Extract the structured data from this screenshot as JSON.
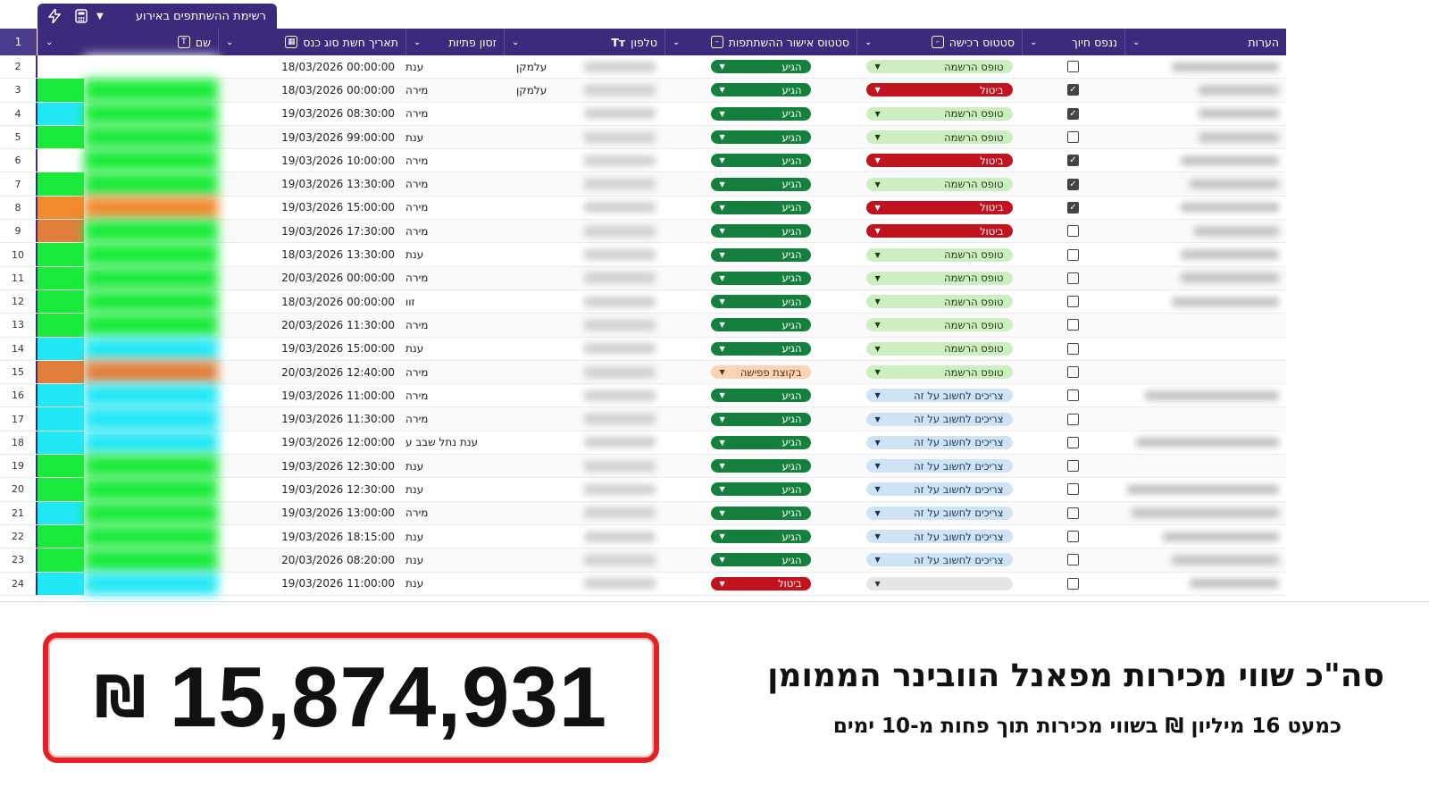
{
  "sheet": {
    "tab_title": "רשימת ההשתתפים באירוע",
    "columns": [
      {
        "key": "name",
        "label": "שם"
      },
      {
        "key": "date",
        "label": "תאריך חשת סוג כנס"
      },
      {
        "key": "slot",
        "label": "זסון פתיות"
      },
      {
        "key": "phone",
        "label": "טלפון"
      },
      {
        "key": "appr",
        "label": "סטטוס אישור ההשתתפות"
      },
      {
        "key": "reg",
        "label": "סטטוס רכישה"
      },
      {
        "key": "check",
        "label": "ננפס חיוך"
      },
      {
        "key": "notes",
        "label": "הערות"
      }
    ],
    "header_row_num": "1",
    "rows": [
      {
        "n": "2",
        "swatch": "#ffffff",
        "blur": "#ffffff",
        "date": "18/03/2026 00:00:00",
        "slot": "ענת",
        "extra": "עלמקן",
        "appr": "הגיע",
        "appr_style": "green",
        "reg": "טופס הרשמה",
        "reg_style": "lightgreen",
        "checked": false,
        "notes_w": 120
      },
      {
        "n": "3",
        "swatch": "#1aeb3a",
        "blur": "#1aeb3a",
        "date": "18/03/2026 00:00:00",
        "slot": "מירה",
        "extra": "עלמקן",
        "appr": "הגיע",
        "appr_style": "green",
        "reg": "ביטול",
        "reg_style": "red",
        "checked": true,
        "notes_w": 90
      },
      {
        "n": "4",
        "swatch": "#22e8f5",
        "blur": "#1aeb3a",
        "date": "19/03/2026 08:30:00",
        "slot": "מירה",
        "extra": "",
        "appr": "הגיע",
        "appr_style": "green",
        "reg": "טופס הרשמה",
        "reg_style": "lightgreen",
        "checked": true,
        "notes_w": 90
      },
      {
        "n": "5",
        "swatch": "#1aeb3a",
        "blur": "#1aeb3a",
        "date": "19/03/2026 99:00:00",
        "slot": "ענת",
        "extra": "",
        "appr": "הגיע",
        "appr_style": "green",
        "reg": "טופס הרשמה",
        "reg_style": "lightgreen",
        "checked": false,
        "notes_w": 90
      },
      {
        "n": "6",
        "swatch": "#ffffff",
        "blur": "#1aeb3a",
        "date": "19/03/2026 10:00:00",
        "slot": "מירה",
        "extra": "",
        "appr": "הגיע",
        "appr_style": "green",
        "reg": "ביטול",
        "reg_style": "red",
        "checked": true,
        "notes_w": 110
      },
      {
        "n": "7",
        "swatch": "#1aeb3a",
        "blur": "#1aeb3a",
        "date": "19/03/2026 13:30:00",
        "slot": "מירה",
        "extra": "",
        "appr": "הגיע",
        "appr_style": "green",
        "reg": "טופס הרשמה",
        "reg_style": "lightgreen",
        "checked": true,
        "notes_w": 100
      },
      {
        "n": "8",
        "swatch": "#f28a2e",
        "blur": "#f28a2e",
        "date": "19/03/2026 15:00:00",
        "slot": "מירה",
        "extra": "",
        "appr": "הגיע",
        "appr_style": "green",
        "reg": "ביטול",
        "reg_style": "red",
        "checked": true,
        "notes_w": 110
      },
      {
        "n": "9",
        "swatch": "#e07f3c",
        "blur": "#1aeb3a",
        "date": "19/03/2026 17:30:00",
        "slot": "מירה",
        "extra": "",
        "appr": "הגיע",
        "appr_style": "green",
        "reg": "ביטול",
        "reg_style": "red",
        "checked": false,
        "notes_w": 95
      },
      {
        "n": "10",
        "swatch": "#1aeb3a",
        "blur": "#1aeb3a",
        "date": "18/03/2026 13:30:00",
        "slot": "ענת",
        "extra": "",
        "appr": "הגיע",
        "appr_style": "green",
        "reg": "טופס הרשמה",
        "reg_style": "lightgreen",
        "checked": false,
        "notes_w": 110
      },
      {
        "n": "11",
        "swatch": "#1aeb3a",
        "blur": "#1aeb3a",
        "date": "20/03/2026 00:00:00",
        "slot": "מירה",
        "extra": "",
        "appr": "הגיע",
        "appr_style": "green",
        "reg": "טופס הרשמה",
        "reg_style": "lightgreen",
        "checked": false,
        "notes_w": 110
      },
      {
        "n": "12",
        "swatch": "#1aeb3a",
        "blur": "#1aeb3a",
        "date": "18/03/2026 00:00:00",
        "slot": "זוו",
        "extra": "",
        "appr": "הגיע",
        "appr_style": "green",
        "reg": "טופס הרשמה",
        "reg_style": "lightgreen",
        "checked": false,
        "notes_w": 120
      },
      {
        "n": "13",
        "swatch": "#1aeb3a",
        "blur": "#1aeb3a",
        "date": "20/03/2026 11:30:00",
        "slot": "מירה",
        "extra": "",
        "appr": "הגיע",
        "appr_style": "green",
        "reg": "טופס הרשמה",
        "reg_style": "lightgreen",
        "checked": false,
        "notes_w": 0
      },
      {
        "n": "14",
        "swatch": "#22e8f5",
        "blur": "#22e8f5",
        "date": "19/03/2026 15:00:00",
        "slot": "ענת",
        "extra": "",
        "appr": "הגיע",
        "appr_style": "green",
        "reg": "טופס הרשמה",
        "reg_style": "lightgreen",
        "checked": false,
        "notes_w": 0
      },
      {
        "n": "15",
        "swatch": "#e07f3c",
        "blur": "#e07f3c",
        "date": "20/03/2026 12:40:00",
        "slot": "מירה",
        "extra": "",
        "appr": "בקוצת פפישה",
        "appr_style": "peach",
        "reg": "טופס הרשמה",
        "reg_style": "lightgreen",
        "checked": false,
        "notes_w": 0
      },
      {
        "n": "16",
        "swatch": "#22e8f5",
        "blur": "#22e8f5",
        "date": "19/03/2026 11:00:00",
        "slot": "מירה",
        "extra": "",
        "appr": "הגיע",
        "appr_style": "green",
        "reg": "צריכים לחשוב על זה",
        "reg_style": "blue",
        "checked": false,
        "notes_w": 150
      },
      {
        "n": "17",
        "swatch": "#22e8f5",
        "blur": "#22e8f5",
        "date": "19/03/2026 11:30:00",
        "slot": "מירה",
        "extra": "",
        "appr": "הגיע",
        "appr_style": "green",
        "reg": "צריכים לחשוב על זה",
        "reg_style": "blue",
        "checked": false,
        "notes_w": 0
      },
      {
        "n": "18",
        "swatch": "#22e8f5",
        "blur": "#22e8f5",
        "date": "19/03/2026 12:00:00",
        "slot": "ענת נתל שבב ע",
        "extra": "",
        "appr": "הגיע",
        "appr_style": "green",
        "reg": "צריכים לחשוב על זה",
        "reg_style": "blue",
        "checked": false,
        "notes_w": 160
      },
      {
        "n": "19",
        "swatch": "#1aeb3a",
        "blur": "#1aeb3a",
        "date": "19/03/2026 12:30:00",
        "slot": "ענת",
        "extra": "",
        "appr": "הגיע",
        "appr_style": "green",
        "reg": "צריכים לחשוב על זה",
        "reg_style": "blue",
        "checked": false,
        "notes_w": 0
      },
      {
        "n": "20",
        "swatch": "#1aeb3a",
        "blur": "#1aeb3a",
        "date": "19/03/2026 12:30:00",
        "slot": "ענת",
        "extra": "",
        "appr": "הגיע",
        "appr_style": "green",
        "reg": "צריכים לחשוב על זה",
        "reg_style": "blue",
        "checked": false,
        "notes_w": 170
      },
      {
        "n": "21",
        "swatch": "#22e8f5",
        "blur": "#1aeb3a",
        "date": "19/03/2026 13:00:00",
        "slot": "מירה",
        "extra": "",
        "appr": "הגיע",
        "appr_style": "green",
        "reg": "צריכים לחשוב על זה",
        "reg_style": "blue",
        "checked": false,
        "notes_w": 165
      },
      {
        "n": "22",
        "swatch": "#1aeb3a",
        "blur": "#1aeb3a",
        "date": "19/03/2026 18:15:00",
        "slot": "ענת",
        "extra": "",
        "appr": "הגיע",
        "appr_style": "green",
        "reg": "צריכים לחשוב על זה",
        "reg_style": "blue",
        "checked": false,
        "notes_w": 130
      },
      {
        "n": "23",
        "swatch": "#1aeb3a",
        "blur": "#1aeb3a",
        "date": "20/03/2026 08:20:00",
        "slot": "ענת",
        "extra": "",
        "appr": "הגיע",
        "appr_style": "green",
        "reg": "צריכים לחשוב על זה",
        "reg_style": "blue",
        "checked": false,
        "notes_w": 120
      },
      {
        "n": "24",
        "swatch": "#22e8f5",
        "blur": "#22e8f5",
        "date": "19/03/2026 11:00:00",
        "slot": "ענת",
        "extra": "",
        "appr": "ביטול",
        "appr_style": "red",
        "reg": "",
        "reg_style": "empty",
        "checked": false,
        "notes_w": 100
      }
    ]
  },
  "pill_colors": {
    "green": {
      "bg": "#15803d",
      "fg": "#ffffff"
    },
    "red": {
      "bg": "#c1121f",
      "fg": "#ffffff"
    },
    "lightgreen": {
      "bg": "#cdeec0",
      "fg": "#1f3d14"
    },
    "blue": {
      "bg": "#cfe3f5",
      "fg": "#13355a"
    },
    "peach": {
      "bg": "#fbd3b5",
      "fg": "#5a2b0c"
    },
    "empty": {
      "bg": "#e6e6e6",
      "fg": "#333333"
    }
  },
  "banner": {
    "amount": "15,874,931",
    "currency": "₪",
    "headline": "סה\"כ שווי מכירות מפאנל הוובינר הממומן",
    "subline": "כמעט 16 מיליון ₪ בשווי מכירות תוך פחות מ-10 ימים"
  }
}
